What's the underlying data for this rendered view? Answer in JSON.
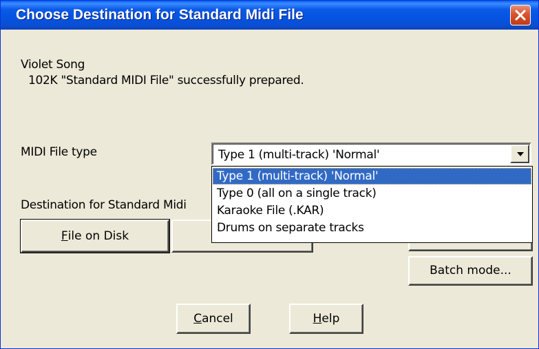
{
  "window": {
    "title": "Choose Destination for Standard Midi File"
  },
  "info": {
    "song_name": "Violet Song",
    "status": "102K \"Standard MIDI File\" successfully prepared."
  },
  "midi_type": {
    "label": "MIDI File type",
    "selected": "Type 1 (multi-track) 'Normal'",
    "options": [
      "Type 1 (multi-track) 'Normal'",
      "Type 0 (all on a single track)",
      "Karaoke File (.KAR)",
      "Drums on separate tracks"
    ]
  },
  "destination": {
    "label": "Destination for Standard Midi",
    "file_on_disk_prefix": "",
    "file_on_disk_mnemonic": "F",
    "file_on_disk_rest": "ile on Disk"
  },
  "buttons": {
    "batch_mode": "Batch mode...",
    "cancel_mnemonic": "C",
    "cancel_rest": "ancel",
    "help_mnemonic": "H",
    "help_rest": "elp"
  },
  "colors": {
    "selection": "#316ac5",
    "titlebar": "#0a5ae8",
    "dialog_bg": "#ece9d8",
    "close": "#d9532f"
  },
  "icons": {
    "close": "close-icon",
    "dropdown": "chevron-down-icon"
  }
}
